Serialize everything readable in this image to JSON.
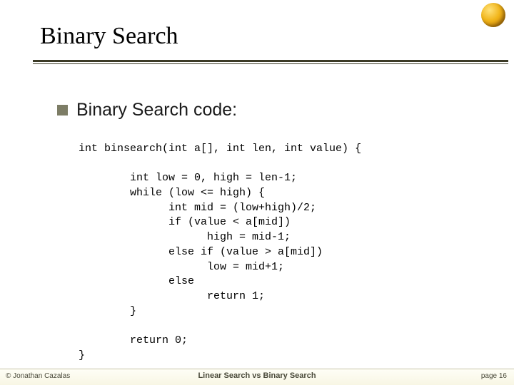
{
  "title": "Binary Search",
  "bullet": "Binary Search code:",
  "code_lines": [
    "int binsearch(int a[], int len, int value) {",
    "",
    "        int low = 0, high = len-1;",
    "        while (low <= high) {",
    "              int mid = (low+high)/2;",
    "              if (value < a[mid])",
    "                    high = mid-1;",
    "              else if (value > a[mid])",
    "                    low = mid+1;",
    "              else",
    "                    return 1;",
    "        }",
    "",
    "        return 0;",
    "}"
  ],
  "footer": {
    "left": "©  Jonathan Cazalas",
    "center": "Linear Search vs Binary Search",
    "right": "page 16"
  }
}
